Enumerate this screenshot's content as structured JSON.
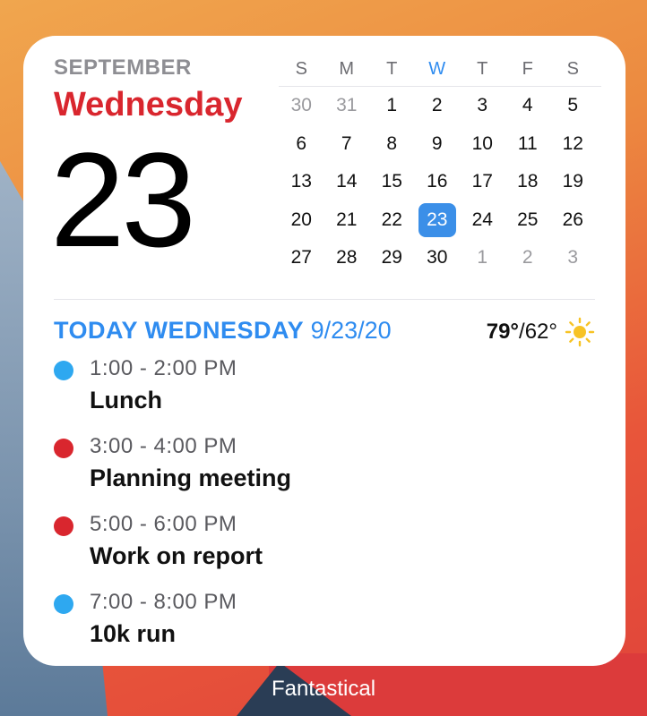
{
  "header": {
    "month": "SEPTEMBER",
    "weekday": "Wednesday",
    "day": "23"
  },
  "calendar": {
    "weekday_letters": [
      "S",
      "M",
      "T",
      "W",
      "T",
      "F",
      "S"
    ],
    "today_index": 3,
    "selected_day": "23",
    "weeks": [
      [
        {
          "d": "30",
          "m": true
        },
        {
          "d": "31",
          "m": true
        },
        {
          "d": "1"
        },
        {
          "d": "2"
        },
        {
          "d": "3"
        },
        {
          "d": "4"
        },
        {
          "d": "5"
        }
      ],
      [
        {
          "d": "6"
        },
        {
          "d": "7"
        },
        {
          "d": "8"
        },
        {
          "d": "9"
        },
        {
          "d": "10"
        },
        {
          "d": "11"
        },
        {
          "d": "12"
        }
      ],
      [
        {
          "d": "13"
        },
        {
          "d": "14"
        },
        {
          "d": "15"
        },
        {
          "d": "16"
        },
        {
          "d": "17"
        },
        {
          "d": "18"
        },
        {
          "d": "19"
        }
      ],
      [
        {
          "d": "20"
        },
        {
          "d": "21"
        },
        {
          "d": "22"
        },
        {
          "d": "23",
          "s": true
        },
        {
          "d": "24"
        },
        {
          "d": "25"
        },
        {
          "d": "26"
        }
      ],
      [
        {
          "d": "27"
        },
        {
          "d": "28"
        },
        {
          "d": "29"
        },
        {
          "d": "30"
        },
        {
          "d": "1",
          "m": true
        },
        {
          "d": "2",
          "m": true
        },
        {
          "d": "3",
          "m": true
        }
      ]
    ]
  },
  "today": {
    "label": "TODAY WEDNESDAY",
    "date": "9/23/20",
    "weather": {
      "high": "79°",
      "low": "/62°",
      "icon": "sun-icon"
    }
  },
  "events": [
    {
      "time": "1:00 - 2:00 PM",
      "title": "Lunch",
      "color": "#2ea8f0"
    },
    {
      "time": "3:00 - 4:00 PM",
      "title": "Planning meeting",
      "color": "#d9262e"
    },
    {
      "time": "5:00 - 6:00 PM",
      "title": "Work on report",
      "color": "#d9262e"
    },
    {
      "time": "7:00 - 8:00 PM",
      "title": "10k run",
      "color": "#2ea8f0"
    }
  ],
  "app": {
    "name": "Fantastical"
  },
  "colors": {
    "accent_red": "#d9262e",
    "accent_blue": "#2f8cf0",
    "selected_bg": "#3b8fe8",
    "sun": "#f7c325"
  }
}
